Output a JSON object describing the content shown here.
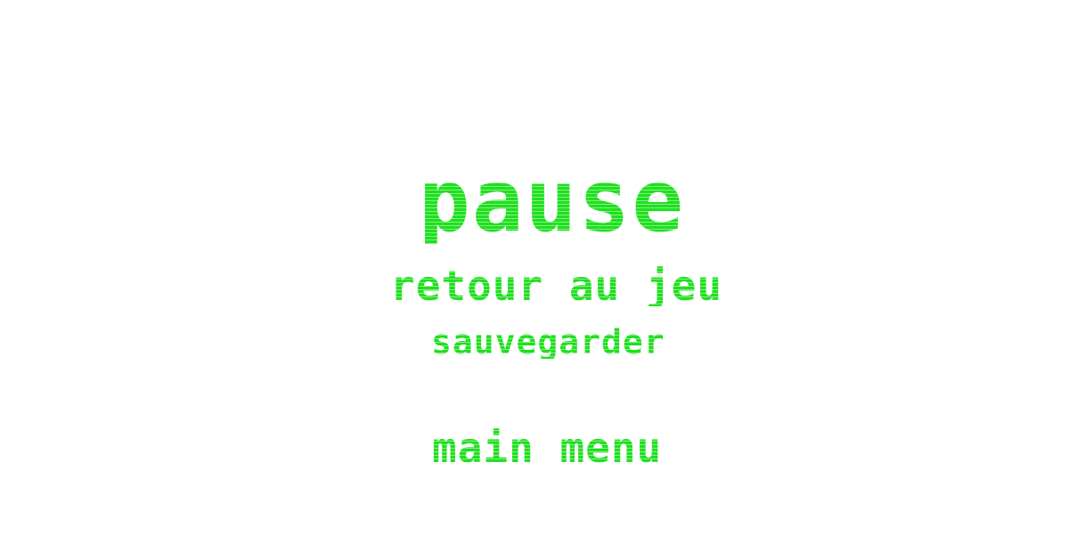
{
  "pause_menu": {
    "title": "pause",
    "items": [
      {
        "label": "retour au jeu"
      },
      {
        "label": "sauvegarder"
      },
      {
        "label": "main menu"
      }
    ]
  },
  "colors": {
    "text": "#1fe01f",
    "background": "#ffffff"
  }
}
